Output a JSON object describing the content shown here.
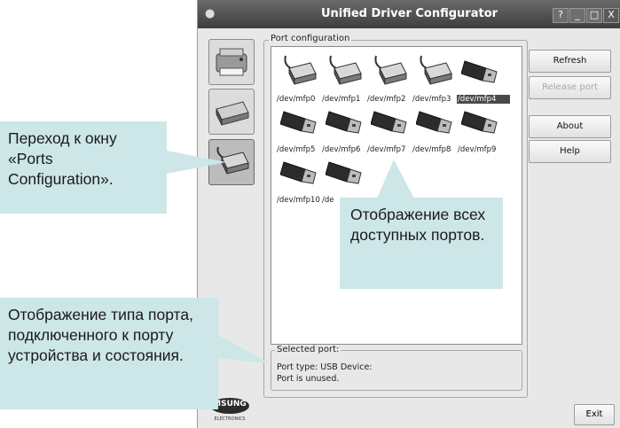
{
  "window": {
    "title": "Unified Driver Configurator",
    "controls": {
      "help": "?",
      "minimize": "_",
      "maximize": "□",
      "close": "X"
    }
  },
  "sidebar": {
    "items": [
      {
        "name": "printers",
        "icon": "printer-icon"
      },
      {
        "name": "scanners",
        "icon": "scanner-icon"
      },
      {
        "name": "ports",
        "icon": "port-connector-icon",
        "active": true
      }
    ]
  },
  "port_config": {
    "label": "Port configuration",
    "ports": [
      {
        "label": "/dev/mfp0",
        "type": "parallel"
      },
      {
        "label": "/dev/mfp1",
        "type": "parallel"
      },
      {
        "label": "/dev/mfp2",
        "type": "parallel"
      },
      {
        "label": "/dev/mfp3",
        "type": "parallel"
      },
      {
        "label": "/dev/mfp4",
        "type": "usb",
        "selected": true
      },
      {
        "label": "/dev/mfp5",
        "type": "usb"
      },
      {
        "label": "/dev/mfp6",
        "type": "usb"
      },
      {
        "label": "/dev/mfp7",
        "type": "usb"
      },
      {
        "label": "/dev/mfp8",
        "type": "usb"
      },
      {
        "label": "/dev/mfp9",
        "type": "usb"
      },
      {
        "label": "/dev/mfp10",
        "type": "usb"
      },
      {
        "label": "/de",
        "type": "usb"
      }
    ]
  },
  "buttons": {
    "refresh": "Refresh",
    "release_port": "Release port",
    "about": "About",
    "help": "Help",
    "exit": "Exit"
  },
  "selected_port": {
    "label": "Selected port:",
    "line1": "Port type: USB   Device:",
    "line2": "Port is unused."
  },
  "logo": {
    "brand": "MSUNG",
    "sub": "ELECTRONICS"
  },
  "callouts": {
    "ports_window": "Переход к окну «Ports Configuration».",
    "all_ports": "Отображение всех доступных портов.",
    "port_type": "Отображение типа порта, подключенного к порту устройства и состояния."
  },
  "colors": {
    "callout_bg": "#cde6e8",
    "titlebar": "#4a4a4a",
    "selection": "#4a4a4a"
  }
}
